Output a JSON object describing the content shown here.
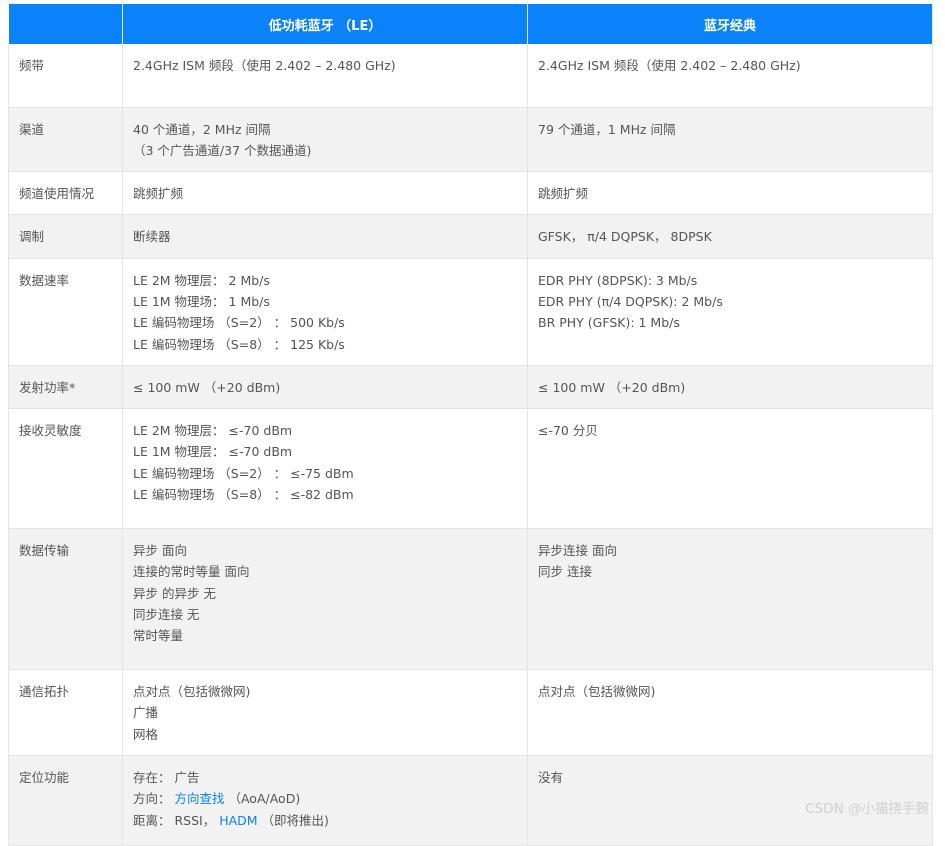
{
  "headers": [
    "",
    "低功耗蓝牙 （LE）",
    "蓝牙经典"
  ],
  "rows": [
    {
      "label": "频带",
      "le": [
        "2.4GHz ISM 频段（使用 2.402 – 2.480 GHz)"
      ],
      "classic": [
        "2.4GHz ISM 频段（使用 2.402 – 2.480 GHz)"
      ]
    },
    {
      "label": "渠道",
      "le": [
        "40 个通道，2 MHz 间隔",
        "（3 个广告通道/37 个数据通道)"
      ],
      "classic": [
        "79 个通道，1 MHz 间隔"
      ]
    },
    {
      "label": "频道使用情况",
      "le": [
        "跳频扩频"
      ],
      "classic": [
        "跳频扩频"
      ]
    },
    {
      "label": "调制",
      "le": [
        "断续器"
      ],
      "classic": [
        "GFSK， π/4 DQPSK， 8DPSK"
      ]
    },
    {
      "label": "数据速率",
      "le": [
        "LE 2M 物理层： 2 Mb/s",
        "LE 1M 物理场： 1 Mb/s",
        "LE 编码物理场 （S=2） ： 500 Kb/s",
        "LE 编码物理场 （S=8） ： 125 Kb/s"
      ],
      "classic": [
        "EDR PHY (8DPSK): 3 Mb/s",
        "EDR PHY (π/4 DQPSK): 2 Mb/s",
        "BR PHY (GFSK): 1 Mb/s"
      ]
    },
    {
      "label": "发射功率*",
      "le": [
        "≤ 100 mW （+20 dBm)"
      ],
      "classic": [
        "≤ 100 mW （+20 dBm)"
      ]
    },
    {
      "label": "接收灵敏度",
      "le": [
        "LE 2M 物理层： ≤-70 dBm",
        "LE 1M 物理层： ≤-70 dBm",
        "LE 编码物理场 （S=2） ： ≤-75 dBm",
        "LE 编码物理场 （S=8） ： ≤-82 dBm"
      ],
      "classic": [
        "≤-70 分贝"
      ]
    },
    {
      "label": "数据传输",
      "le": [
        "异步 面向",
        "连接的常时等量 面向",
        "异步 的异步 无",
        "同步连接 无",
        "常时等量"
      ],
      "classic": [
        "异步连接 面向",
        "同步 连接"
      ]
    },
    {
      "label": "通信拓扑",
      "le": [
        "点对点（包括微微网)",
        "广播",
        "网格"
      ],
      "classic": [
        "点对点（包括微微网)"
      ]
    },
    {
      "label": "定位功能",
      "le": {
        "presence": {
          "prefix": "存在： ",
          "text": "广告"
        },
        "direction": {
          "prefix": "方向： ",
          "link": "方向查找",
          "suffix": " （AoA/AoD)"
        },
        "distance": {
          "prefix": "距离： RSSI， ",
          "link": "HADM",
          "suffix": " （即将推出)"
        }
      },
      "classic": [
        "没有"
      ]
    }
  ],
  "watermark": "CSDN @小猫挠手腕"
}
